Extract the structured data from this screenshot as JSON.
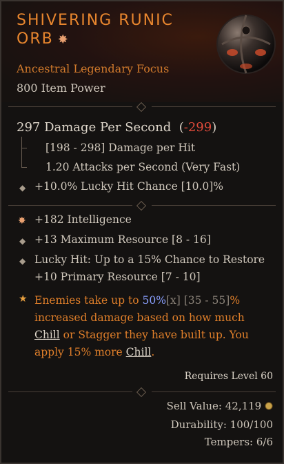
{
  "item": {
    "title_line1": "SHIVERING RUNIC",
    "title_line2": "ORB",
    "subtype": "Ancestral Legendary Focus",
    "power": "800 Item Power"
  },
  "damage": {
    "dps": "297 Damage Per Second",
    "delta_open": "(",
    "delta": "-299",
    "delta_close": ")",
    "per_hit": "[198 - 298] Damage per Hit",
    "attacks": "1.20 Attacks per Second (Very Fast)",
    "lucky": "+10.0% Lucky Hit Chance [10.0]%"
  },
  "affixes": {
    "intelligence": "+182 Intelligence",
    "max_resource": "+13 Maximum Resource [8 - 16]",
    "lucky_line1": "Lucky Hit: Up to a 15% Chance to Restore",
    "lucky_line2": "+10 Primary Resource [7 - 10]"
  },
  "legendary": {
    "p1": "Enemies take up to ",
    "value": "50%",
    "x": "[x]",
    "range": " [35 - 55]",
    "p2": "% increased damage based on how much ",
    "chill1": "Chill",
    "p3": " or Stagger they have built up. You apply 15% more ",
    "chill2": "Chill",
    "p4": "."
  },
  "footer": {
    "requires": "Requires Level 60",
    "sell": "Sell Value: 42,119",
    "durability": "Durability: 100/100",
    "tempers": "Tempers: 6/6"
  },
  "colors": {
    "legendary": "#e07f2a",
    "negative": "#e04a3a",
    "highlight": "#8aa0ff"
  }
}
